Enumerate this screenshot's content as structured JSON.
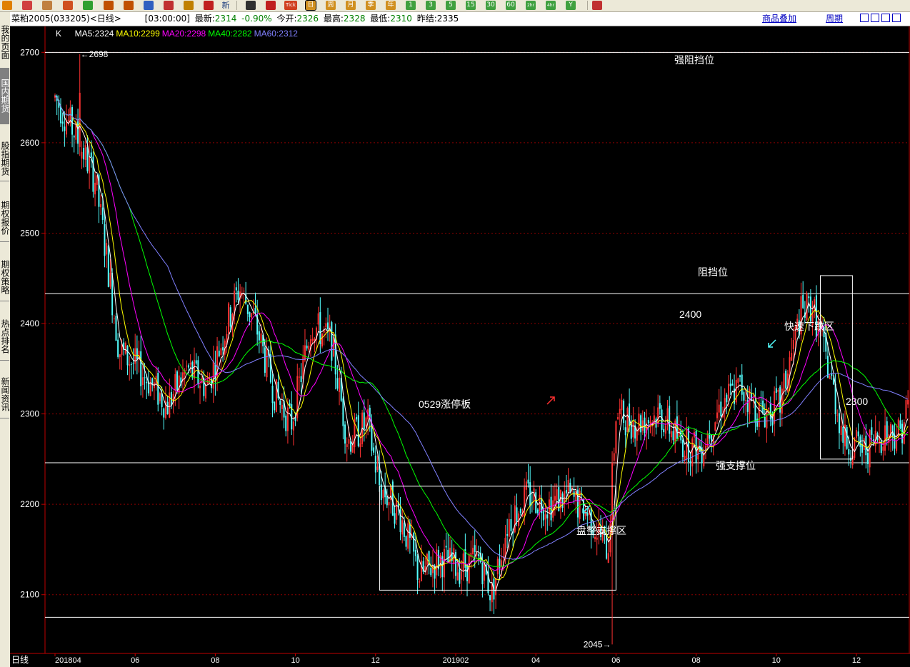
{
  "toolbar": {
    "icons": [
      "arrow-icon",
      "home-icon",
      "folder-icon",
      "f10-icon",
      "refresh-icon",
      "zoom-in-icon",
      "zoom-out-icon",
      "window-icon",
      "pen-icon",
      "bell-icon",
      "pin-icon",
      "news-icon",
      "table-icon",
      "chart-icon",
      "tick-icon",
      "calendar-icon"
    ],
    "news_label": "新",
    "tick_label": "Tick",
    "periods": [
      "日",
      "周",
      "月",
      "季",
      "年",
      "1",
      "3",
      "5",
      "15",
      "30",
      "60",
      "2hr",
      "4hr",
      "Y"
    ]
  },
  "info": {
    "symbol": "菜粕2005(033205)<日线>",
    "time": "[03:00:00]",
    "last_label": "最新:",
    "last": "2314",
    "change": "-0.90%",
    "open_label": "今开:",
    "open": "2326",
    "high_label": "最高:",
    "high": "2328",
    "low_label": "最低:",
    "low": "2310",
    "prev_label": "昨结:",
    "prev": "2335",
    "overlay_link": "商品叠加",
    "period_link": "周期"
  },
  "sidebar": {
    "tabs": [
      "我的页面",
      "国内期货",
      "股指期货",
      "期权报价",
      "期权策略",
      "热点排名",
      "新闻资讯"
    ],
    "active": 1
  },
  "chart_data": {
    "type": "candlestick",
    "ylim": [
      2035,
      2720
    ],
    "yticks": [
      2100,
      2200,
      2300,
      2400,
      2500,
      2600,
      2700
    ],
    "legend": [
      {
        "label": "K",
        "color": "#ffffff"
      },
      {
        "label": "MA5:2324",
        "color": "#ffffff"
      },
      {
        "label": "MA10:2299",
        "color": "#ffff00"
      },
      {
        "label": "MA20:2298",
        "color": "#ff00ff"
      },
      {
        "label": "MA40:2282",
        "color": "#00ff00"
      },
      {
        "label": "MA60:2312",
        "color": "#8080ff"
      }
    ],
    "xlabels": [
      "日线",
      "201804",
      "06",
      "08",
      "10",
      "12",
      "201902",
      "04",
      "06",
      "08",
      "10",
      "12"
    ],
    "annotations": {
      "high_label": "2698",
      "low_label": "2045",
      "strong_resistance": "强阻挡位",
      "resistance": "阻挡位",
      "level_2400": "2400",
      "fast_drop": "快速下跌区",
      "limit_up": "0529涨停板",
      "strong_support": "强支撑位",
      "consolidation": "盘整支撑区",
      "level_2300": "2300"
    },
    "h_levels": [
      2700,
      2433,
      2246,
      2075
    ],
    "colors": {
      "up": "#ff3232",
      "down": "#54ffff",
      "grid": "#8b0000",
      "level": "#ffffff"
    },
    "anchors": [
      {
        "m": 0,
        "p": 2650
      },
      {
        "m": 0.5,
        "p": 2610
      },
      {
        "m": 1,
        "p": 2560
      },
      {
        "m": 1.3,
        "p": 2470
      },
      {
        "m": 1.6,
        "p": 2370
      },
      {
        "m": 2.1,
        "p": 2350
      },
      {
        "m": 2.8,
        "p": 2310
      },
      {
        "m": 3.3,
        "p": 2350
      },
      {
        "m": 3.8,
        "p": 2330
      },
      {
        "m": 4.3,
        "p": 2400
      },
      {
        "m": 4.6,
        "p": 2440
      },
      {
        "m": 5.0,
        "p": 2400
      },
      {
        "m": 5.5,
        "p": 2320
      },
      {
        "m": 5.9,
        "p": 2290
      },
      {
        "m": 6.4,
        "p": 2400
      },
      {
        "m": 6.9,
        "p": 2380
      },
      {
        "m": 7.3,
        "p": 2270
      },
      {
        "m": 7.8,
        "p": 2290
      },
      {
        "m": 8.1,
        "p": 2220
      },
      {
        "m": 8.6,
        "p": 2190
      },
      {
        "m": 9.1,
        "p": 2120
      },
      {
        "m": 9.6,
        "p": 2140
      },
      {
        "m": 10.1,
        "p": 2130
      },
      {
        "m": 10.6,
        "p": 2140
      },
      {
        "m": 10.9,
        "p": 2100
      },
      {
        "m": 11.3,
        "p": 2180
      },
      {
        "m": 11.8,
        "p": 2210
      },
      {
        "m": 12.3,
        "p": 2200
      },
      {
        "m": 12.8,
        "p": 2210
      },
      {
        "m": 13.3,
        "p": 2190
      },
      {
        "m": 13.8,
        "p": 2150
      },
      {
        "m": 14.0,
        "p": 2300
      },
      {
        "m": 14.5,
        "p": 2290
      },
      {
        "m": 15.1,
        "p": 2300
      },
      {
        "m": 15.6,
        "p": 2270
      },
      {
        "m": 16.1,
        "p": 2260
      },
      {
        "m": 16.6,
        "p": 2310
      },
      {
        "m": 17.1,
        "p": 2330
      },
      {
        "m": 17.6,
        "p": 2300
      },
      {
        "m": 18.1,
        "p": 2310
      },
      {
        "m": 18.6,
        "p": 2410
      },
      {
        "m": 18.9,
        "p": 2420
      },
      {
        "m": 19.3,
        "p": 2350
      },
      {
        "m": 19.7,
        "p": 2270
      },
      {
        "m": 20.2,
        "p": 2260
      },
      {
        "m": 20.7,
        "p": 2280
      },
      {
        "m": 21.1,
        "p": 2280
      },
      {
        "m": 21.3,
        "p": 2314
      }
    ]
  }
}
